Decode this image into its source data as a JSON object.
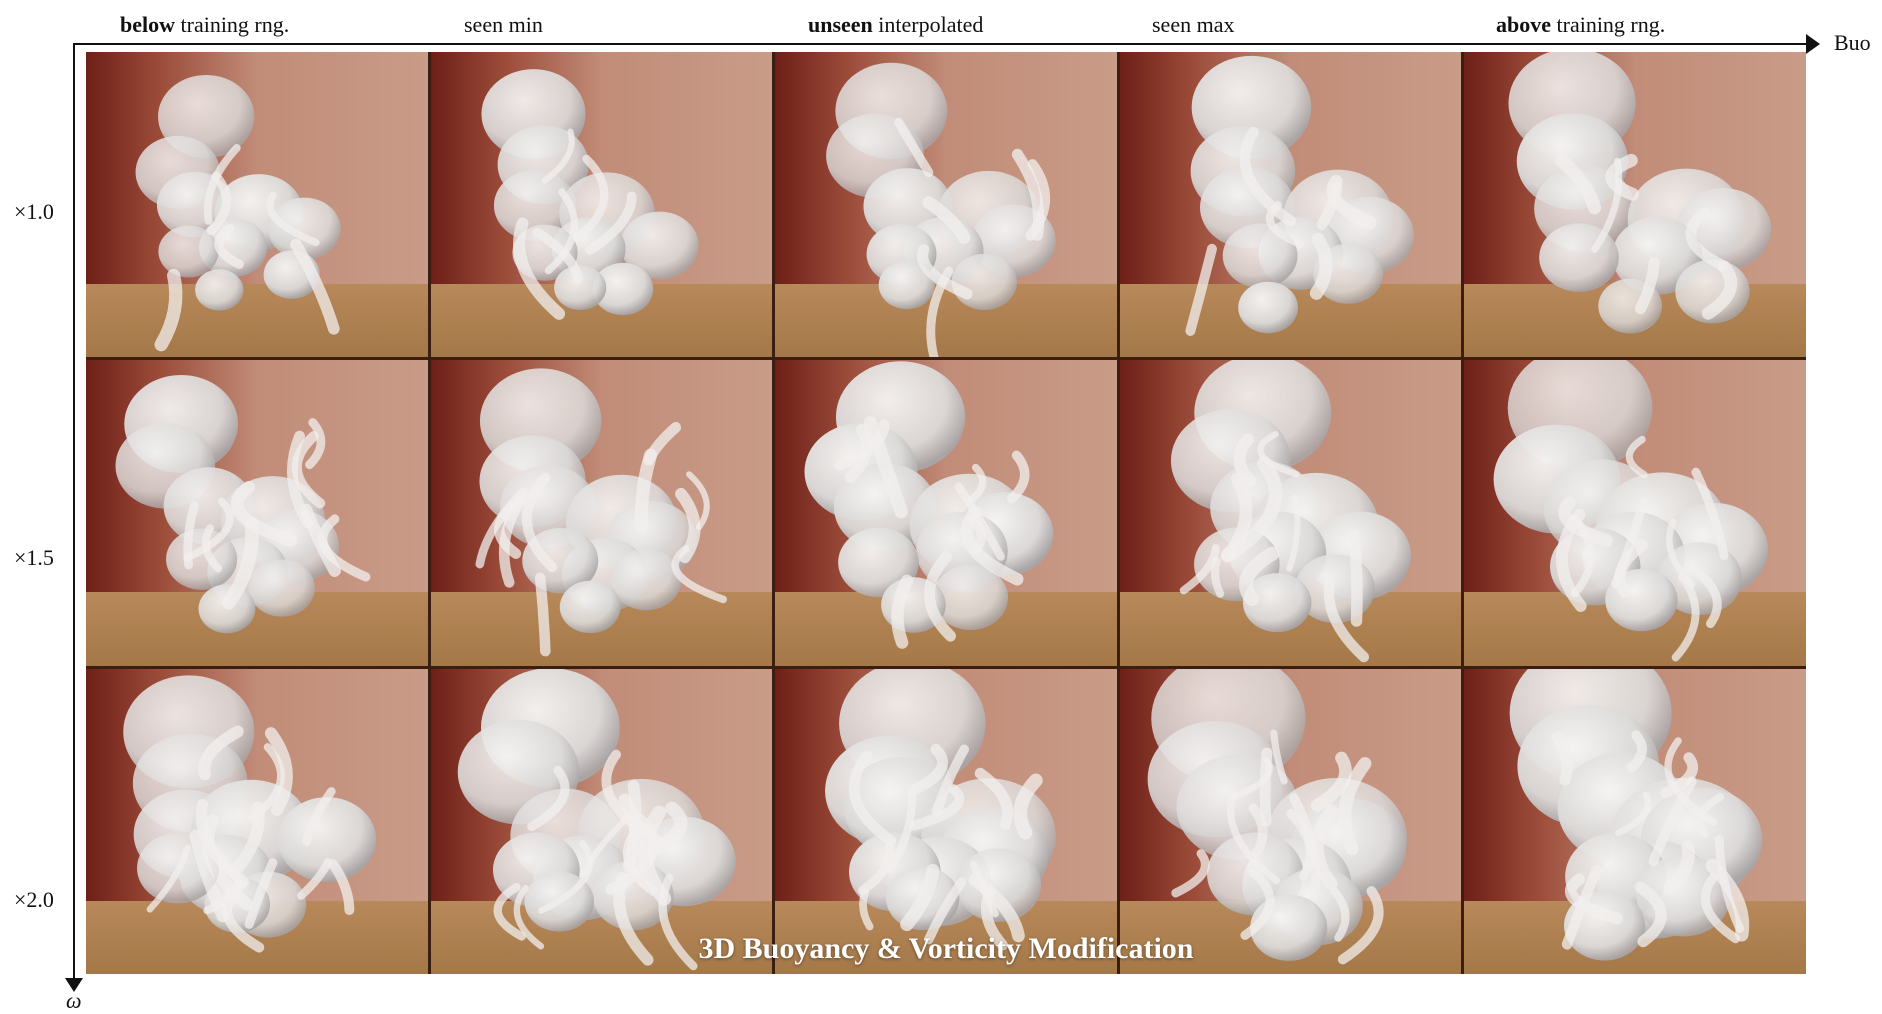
{
  "columns": [
    {
      "bold": "below",
      "rest": " training rng."
    },
    {
      "bold": "",
      "rest": "seen min"
    },
    {
      "bold": "unseen",
      "rest": " interpolated"
    },
    {
      "bold": "",
      "rest": "seen max"
    },
    {
      "bold": "above",
      "rest": " training rng."
    }
  ],
  "rows": [
    "×1.0",
    "×1.5",
    "×2.0"
  ],
  "x_axis_label": "Buo",
  "y_axis_label": "ω",
  "title": "3D Buoyancy & Vorticity Modification",
  "colors": {
    "wall_dark": "#6e1f17",
    "wall_light": "#c99c88",
    "floor": "#b8895a",
    "smoke": "#ecebea"
  }
}
